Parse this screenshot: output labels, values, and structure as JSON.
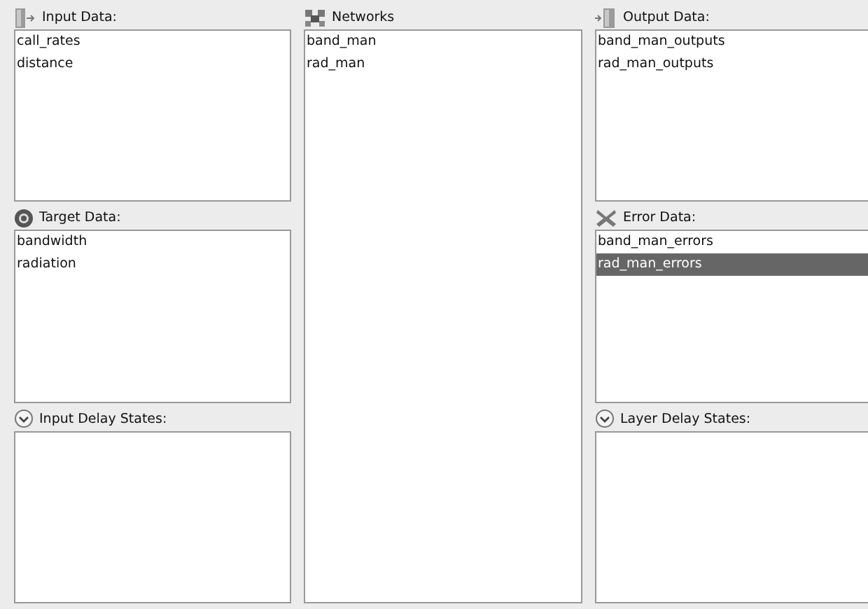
{
  "columns": [
    {
      "panels": [
        {
          "kind": "input",
          "title": "Input Data:",
          "items": [
            {
              "label": "call_rates",
              "selected": false
            },
            {
              "label": "distance",
              "selected": false
            }
          ]
        },
        {
          "kind": "target",
          "title": "Target Data:",
          "items": [
            {
              "label": "bandwidth",
              "selected": false
            },
            {
              "label": "radiation",
              "selected": false
            }
          ]
        },
        {
          "kind": "delay",
          "title": "Input Delay States:"
        }
      ]
    },
    {
      "panels": [
        {
          "kind": "network",
          "title": "Networks",
          "items": [
            {
              "label": "band_man",
              "selected": false
            },
            {
              "label": "rad_man",
              "selected": false
            }
          ]
        }
      ]
    },
    {
      "panels": [
        {
          "kind": "output",
          "title": "Output Data:",
          "items": [
            {
              "label": "band_man_outputs",
              "selected": false
            },
            {
              "label": "rad_man_outputs",
              "selected": false
            }
          ]
        },
        {
          "kind": "error",
          "title": "Error Data:",
          "items": [
            {
              "label": "band_man_errors",
              "selected": false
            },
            {
              "label": "rad_man_errors",
              "selected": true
            }
          ]
        },
        {
          "kind": "delay",
          "title": "Layer Delay States:"
        }
      ]
    }
  ]
}
